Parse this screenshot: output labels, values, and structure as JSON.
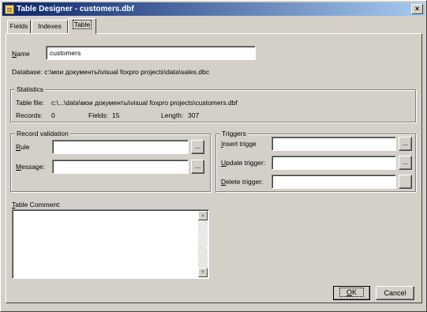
{
  "window": {
    "title": "Table Designer - customers.dbf",
    "close_label": "×"
  },
  "tabs": [
    {
      "label": "Fields",
      "active": false
    },
    {
      "label": "Indexes",
      "active": false
    },
    {
      "label": "Table",
      "active": true
    }
  ],
  "table_tab": {
    "name_label_prefix": "N",
    "name_label_rest": "ame",
    "name_value": "customers",
    "database_text": "Database: c:\\мои документы\\visual foxpro projects\\data\\sales.dbc",
    "statistics": {
      "title": "Statistics",
      "table_file_label": "Table file:",
      "table_file_value": "c:\\...\\data\\мои документы\\visual foxpro projects\\customers.dbf",
      "records_label": "Records:",
      "records_value": "0",
      "fields_label": "Fields:",
      "fields_value": "15",
      "length_label": "Length:",
      "length_value": "307"
    },
    "record_validation": {
      "title": "Record validation",
      "rule_label_prefix": "R",
      "rule_label_rest": "ule",
      "rule_value": "",
      "message_label_prefix": "M",
      "message_label_rest": "essage:",
      "message_value": "",
      "ellipsis": "..."
    },
    "triggers": {
      "title": "Triggers",
      "insert_label_prefix": "I",
      "insert_label_rest": "nsert trigge",
      "insert_value": "",
      "update_label_prefix": "U",
      "update_label_rest": "pdate trigger:",
      "update_value": "",
      "delete_label_prefix": "D",
      "delete_label_rest": "elete trigger:",
      "delete_value": "",
      "ellipsis": "..."
    },
    "comment": {
      "label_prefix": "T",
      "label_rest": "able Comment:",
      "value": ""
    }
  },
  "buttons": {
    "ok_prefix": "O",
    "ok_rest": "K",
    "cancel": "Cancel"
  },
  "colors": {
    "titlebar_start": "#0a246a",
    "titlebar_end": "#a6caf0",
    "face": "#d4d0c8"
  }
}
